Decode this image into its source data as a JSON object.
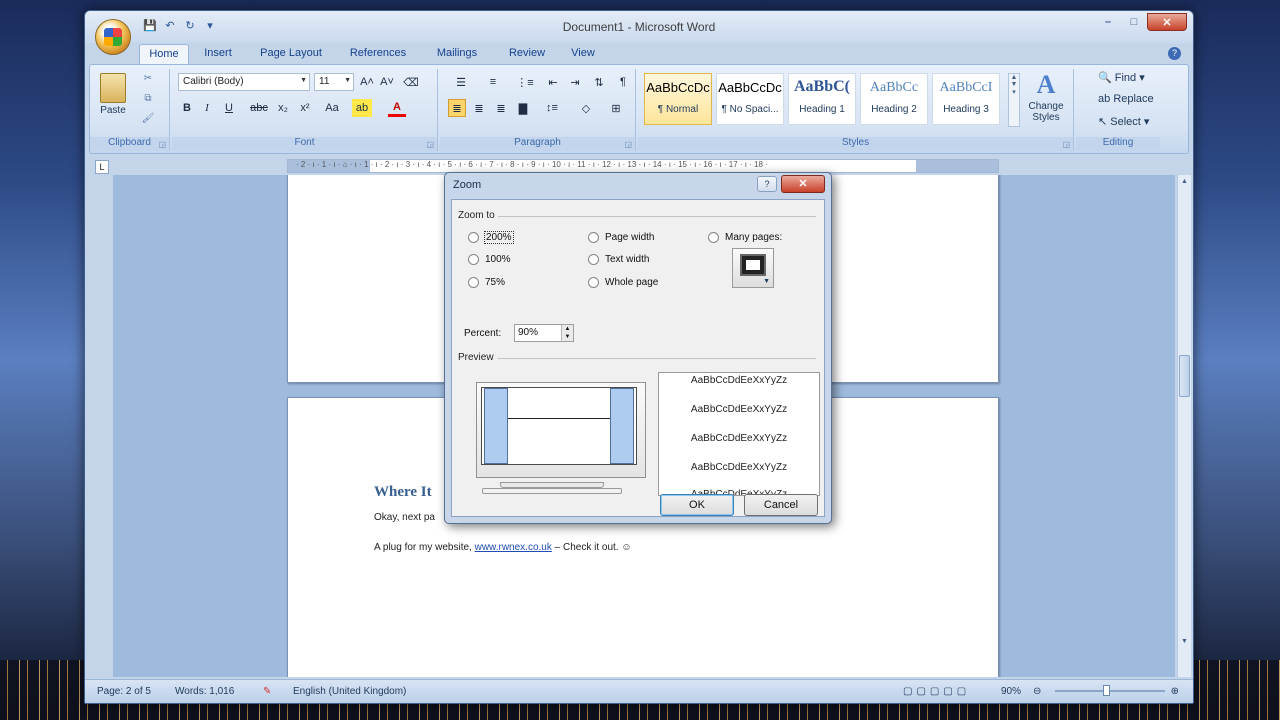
{
  "window": {
    "title": "Document1 - Microsoft Word",
    "controls": {
      "minimize": "–",
      "maximize": "□",
      "close": "✕"
    }
  },
  "qat": {
    "save": "💾",
    "undo": "↶",
    "redo": "↻",
    "more": "▾"
  },
  "tabs": [
    "Home",
    "Insert",
    "Page Layout",
    "References",
    "Mailings",
    "Review",
    "View"
  ],
  "ribbon": {
    "clipboard": {
      "label": "Clipboard",
      "paste": "Paste"
    },
    "font": {
      "label": "Font",
      "family": "Calibri (Body)",
      "size": "11",
      "grow": "A˄",
      "shrink": "A˅",
      "clear": "⌫",
      "bold": "B",
      "italic": "I",
      "underline": "U",
      "strike": "abc",
      "subscript": "x₂",
      "superscript": "x²",
      "case": "Aa",
      "highlight": "ab",
      "color": "A"
    },
    "paragraph": {
      "label": "Paragraph"
    },
    "styles": {
      "label": "Styles",
      "items": [
        {
          "sample": "AaBbCcDc",
          "name": "¶ Normal"
        },
        {
          "sample": "AaBbCcDc",
          "name": "¶ No Spaci..."
        },
        {
          "sample": "AaBbC(",
          "name": "Heading 1"
        },
        {
          "sample": "AaBbCc",
          "name": "Heading 2"
        },
        {
          "sample": "AaBbCcI",
          "name": "Heading 3"
        }
      ],
      "change": "Change Styles"
    },
    "editing": {
      "label": "Editing",
      "find": "Find",
      "replace": "Replace",
      "select": "Select"
    }
  },
  "ruler_text": "· 2 · ı · 1 · ı · ⌂ · ı · 1 · ı · 2 · ı · 3 · ı · 4 · ı · 5 · ı · 6 · ı · 7 · ı · 8 · ı · 9 · ı · 10 · ı · 11 · ı · 12 · ı · 13 · ı · 14 · ı · 15 · ı · 16 · ı · 17 · ı · 18 ·",
  "document": {
    "heading": "Where It",
    "line1": "Okay, next pa",
    "line2_prefix": "A plug for my website, ",
    "line2_link": "www.rwnex.co.uk",
    "line2_suffix": " – Check it out. ☺"
  },
  "status": {
    "page": "Page: 2 of 5",
    "words": "Words: 1,016",
    "language": "English (United Kingdom)",
    "zoom": "90%"
  },
  "zoom_dialog": {
    "title": "Zoom",
    "help": "?",
    "close": "✕",
    "zoom_to_label": "Zoom to",
    "options": {
      "p200": "200%",
      "p100": "100%",
      "p75": "75%",
      "page_width": "Page width",
      "text_width": "Text width",
      "whole_page": "Whole page",
      "many_pages": "Many pages:"
    },
    "percent_label": "Percent:",
    "percent_value": "90%",
    "preview_label": "Preview",
    "sample_text": "AaBbCcDdEeXxYyZz",
    "ok": "OK",
    "cancel": "Cancel"
  }
}
